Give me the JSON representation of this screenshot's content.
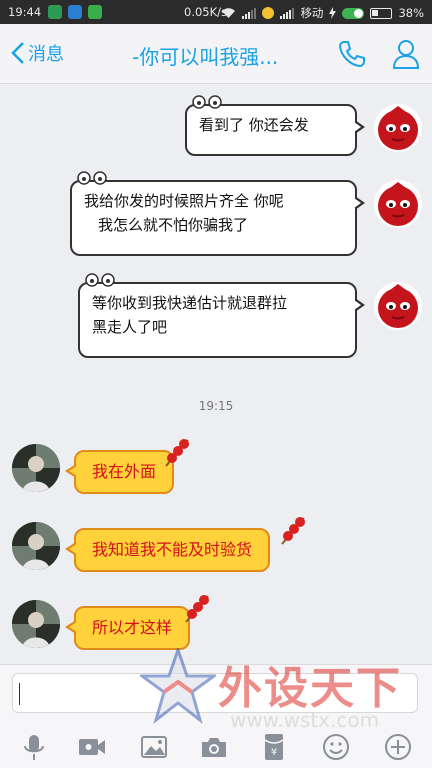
{
  "status_bar": {
    "time": "19:44",
    "network_speed": "0.05K/s",
    "carrier": "移动",
    "battery": "38%"
  },
  "header": {
    "back_label": "消息",
    "title": "-你可以叫我强..."
  },
  "messages_right": [
    {
      "lines": [
        "看到了 你还会发"
      ]
    },
    {
      "lines": [
        "我给你发的时候照片齐全 你呢",
        "我怎么就不怕你骗我了"
      ]
    },
    {
      "lines": [
        "等你收到我快递估计就退群拉",
        "黑走人了吧"
      ]
    }
  ],
  "timestamp": "19:15",
  "messages_left": [
    {
      "text": "我在外面"
    },
    {
      "text": "我知道我不能及时验货"
    },
    {
      "text": "所以才这样"
    }
  ],
  "watermark": {
    "brand": "外设天下",
    "url": "www.wstx.com"
  },
  "colors": {
    "accent": "#1aa1e6",
    "bubble_left_fill": "#ffd13b",
    "bubble_left_text": "#d4101a"
  }
}
